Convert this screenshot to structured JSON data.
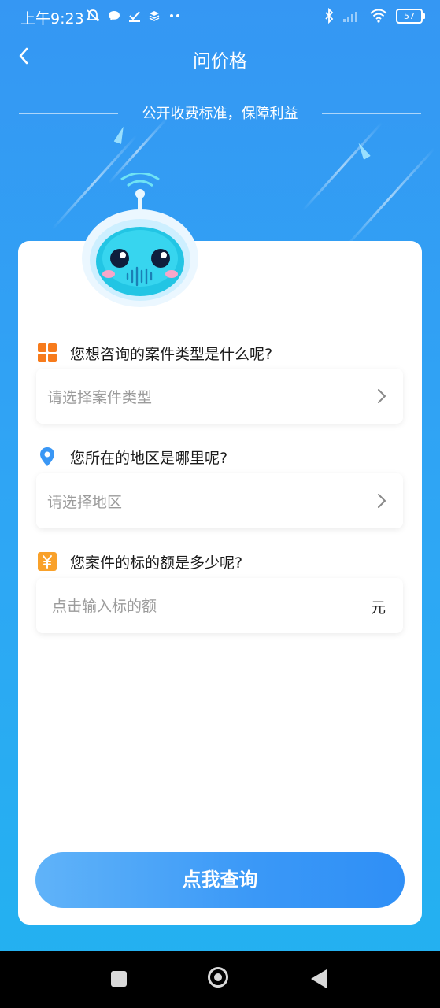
{
  "status_bar": {
    "time": "上午9:23",
    "left_icons": [
      "mute-bell-icon",
      "chat-bubble-icon",
      "check-icon",
      "layers-icon",
      "more-dots-icon"
    ],
    "right_icons": [
      "bluetooth-icon",
      "signal-icon",
      "wifi-icon",
      "battery-icon"
    ],
    "battery_level": "57"
  },
  "nav": {
    "title": "问价格",
    "back_icon": "chevron-left-icon"
  },
  "slogan": "公开收费标准，保障利益",
  "form": {
    "case_type": {
      "question": "您想咨询的案件类型是什么呢?",
      "placeholder": "请选择案件类型",
      "icon": "grid-icon",
      "icon_color": "#f77b1c"
    },
    "region": {
      "question": "您所在的地区是哪里呢?",
      "placeholder": "请选择地区",
      "icon": "location-pin-icon",
      "icon_color": "#3a97f5"
    },
    "amount": {
      "question": "您案件的标的额是多少呢?",
      "placeholder": "点击输入标的额",
      "unit": "元",
      "icon": "yuan-icon",
      "icon_color": "#f9a12a"
    }
  },
  "query_button": {
    "label": "点我查询"
  },
  "colors": {
    "background_top": "#3597f3",
    "background_bottom": "#22b2f0",
    "button": "#3a98f7"
  },
  "system_nav": {
    "icons": [
      "recent-apps-icon",
      "home-icon",
      "back-triangle-icon"
    ]
  }
}
